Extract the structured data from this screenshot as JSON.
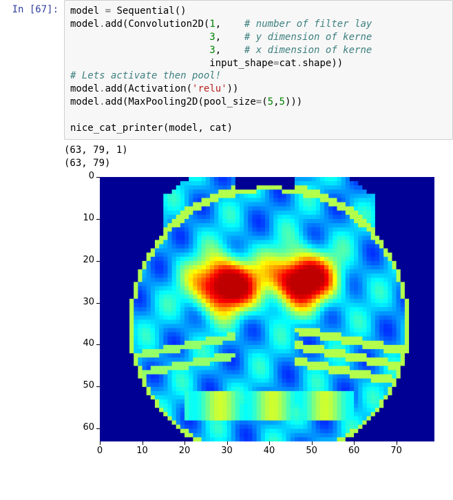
{
  "cell": {
    "prompt": "In [67]:",
    "code_lines": [
      {
        "segments": [
          {
            "t": "model ",
            "c": "tok-name"
          },
          {
            "t": "= ",
            "c": "tok-op"
          },
          {
            "t": "Sequential",
            "c": "tok-name"
          },
          {
            "t": "()",
            "c": "tok-name"
          }
        ]
      },
      {
        "segments": [
          {
            "t": "model",
            "c": "tok-name"
          },
          {
            "t": ".",
            "c": "tok-op"
          },
          {
            "t": "add",
            "c": "tok-name"
          },
          {
            "t": "(Convolution2D(",
            "c": "tok-name"
          },
          {
            "t": "1",
            "c": "tok-num"
          },
          {
            "t": ",    ",
            "c": "tok-name"
          },
          {
            "t": "# number of filter lay",
            "c": "tok-cmt"
          }
        ]
      },
      {
        "segments": [
          {
            "t": "                        ",
            "c": "tok-name"
          },
          {
            "t": "3",
            "c": "tok-num"
          },
          {
            "t": ",    ",
            "c": "tok-name"
          },
          {
            "t": "# y dimension of kerne",
            "c": "tok-cmt"
          }
        ]
      },
      {
        "segments": [
          {
            "t": "                        ",
            "c": "tok-name"
          },
          {
            "t": "3",
            "c": "tok-num"
          },
          {
            "t": ",    ",
            "c": "tok-name"
          },
          {
            "t": "# x dimension of kerne",
            "c": "tok-cmt"
          }
        ]
      },
      {
        "segments": [
          {
            "t": "                        input_shape",
            "c": "tok-name"
          },
          {
            "t": "=",
            "c": "tok-op"
          },
          {
            "t": "cat",
            "c": "tok-name"
          },
          {
            "t": ".",
            "c": "tok-op"
          },
          {
            "t": "shape))",
            "c": "tok-name"
          }
        ]
      },
      {
        "segments": [
          {
            "t": "# Lets activate then pool!",
            "c": "tok-cmt"
          }
        ]
      },
      {
        "segments": [
          {
            "t": "model",
            "c": "tok-name"
          },
          {
            "t": ".",
            "c": "tok-op"
          },
          {
            "t": "add",
            "c": "tok-name"
          },
          {
            "t": "(Activation(",
            "c": "tok-name"
          },
          {
            "t": "'relu'",
            "c": "tok-str"
          },
          {
            "t": "))",
            "c": "tok-name"
          }
        ]
      },
      {
        "segments": [
          {
            "t": "model",
            "c": "tok-name"
          },
          {
            "t": ".",
            "c": "tok-op"
          },
          {
            "t": "add",
            "c": "tok-name"
          },
          {
            "t": "(MaxPooling2D(pool_size",
            "c": "tok-name"
          },
          {
            "t": "=",
            "c": "tok-op"
          },
          {
            "t": "(",
            "c": "tok-name"
          },
          {
            "t": "5",
            "c": "tok-num"
          },
          {
            "t": ",",
            "c": "tok-name"
          },
          {
            "t": "5",
            "c": "tok-num"
          },
          {
            "t": ")))",
            "c": "tok-name"
          }
        ]
      },
      {
        "segments": [
          {
            "t": "",
            "c": "tok-name"
          }
        ]
      },
      {
        "segments": [
          {
            "t": "nice_cat_printer",
            "c": "tok-name"
          },
          {
            "t": "(model, cat)",
            "c": "tok-name"
          }
        ]
      }
    ]
  },
  "stdout": [
    "(63, 79, 1)",
    "(63, 79)"
  ],
  "chart_data": {
    "type": "heatmap",
    "title": "",
    "xlabel": "",
    "ylabel": "",
    "xlim": [
      0,
      79
    ],
    "ylim": [
      0,
      63
    ],
    "x_ticks": [
      0,
      10,
      20,
      30,
      40,
      50,
      60,
      70
    ],
    "y_ticks": [
      0,
      10,
      20,
      30,
      40,
      50,
      60
    ],
    "colormap": "jet",
    "description": "Feature-map heatmap of a cat after Conv2D+ReLU+MaxPool; background deep navy, cat body mid blue/cyan, strong green/yellow/red activations around eyes, whiskers, and ear/face edges.",
    "shape": [
      63,
      79
    ]
  }
}
